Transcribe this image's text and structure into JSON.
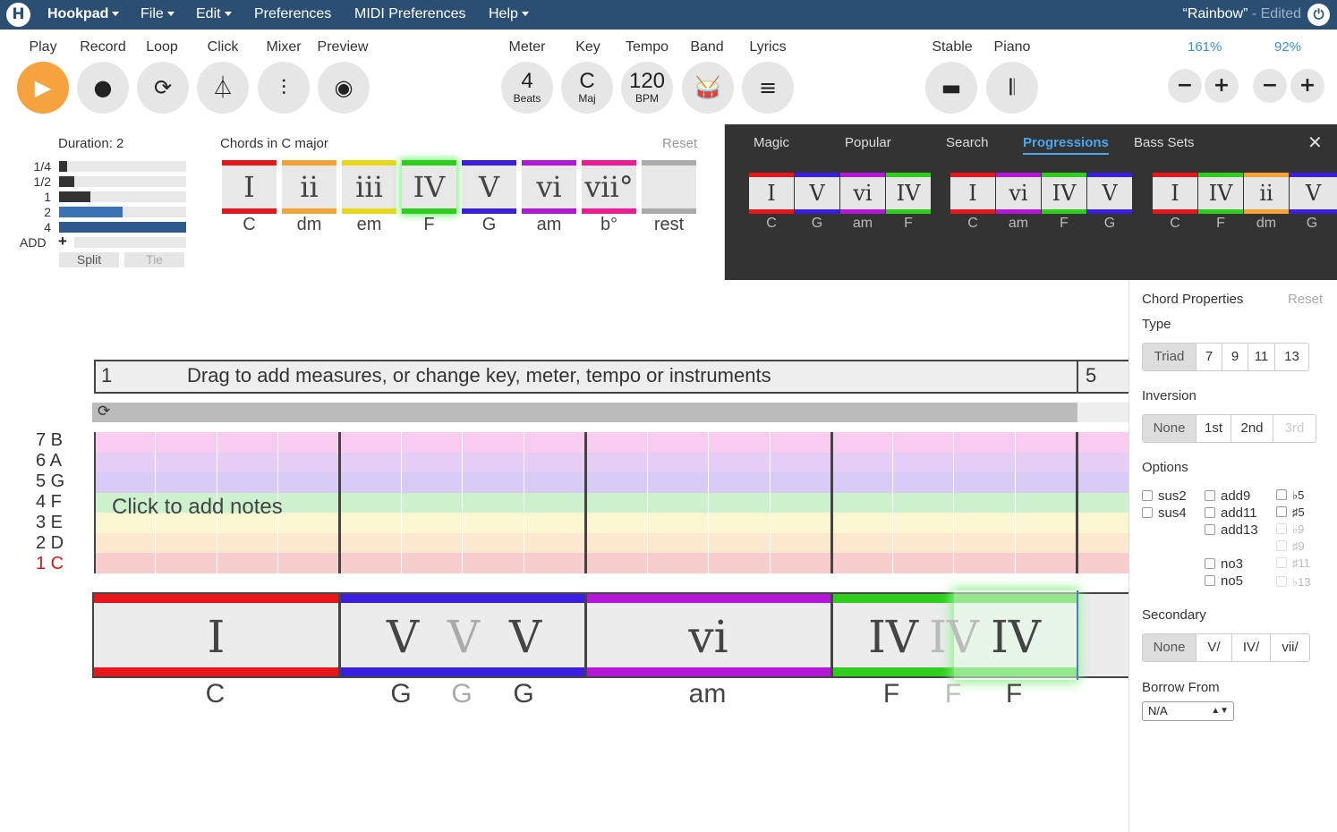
{
  "menubar": {
    "logo": "H",
    "app": "Hookpad",
    "items": [
      "File",
      "Edit",
      "Preferences",
      "MIDI Preferences",
      "Help"
    ],
    "doc_title": "“Rainbow”",
    "doc_status": "- Edited"
  },
  "toolbar": {
    "play": "Play",
    "record": "Record",
    "loop": "Loop",
    "click": "Click",
    "mixer": "Mixer",
    "preview": "Preview",
    "meter": "Meter",
    "meter_value": "4",
    "meter_unit": "Beats",
    "key": "Key",
    "key_value": "C",
    "key_unit": "Maj",
    "tempo": "Tempo",
    "tempo_value": "120",
    "tempo_unit": "BPM",
    "band": "Band",
    "lyrics": "Lyrics",
    "stable": "Stable",
    "piano": "Piano",
    "zoom1": "161%",
    "zoom2": "92%",
    "minus": "−",
    "plus": "+"
  },
  "duration": {
    "title": "Duration:",
    "value": "2",
    "rows": [
      {
        "label": "1/4",
        "level": 0.06
      },
      {
        "label": "1/2",
        "level": 0.12
      },
      {
        "label": "1",
        "level": 0.25
      },
      {
        "label": "2",
        "level": 0.5
      },
      {
        "label": "4",
        "level": 1.0
      }
    ],
    "add": "ADD",
    "add_icon": "+",
    "split": "Split",
    "tie": "Tie"
  },
  "palette": {
    "title": "Chords in C major",
    "reset": "Reset",
    "chords": [
      {
        "rn": "I",
        "name": "C",
        "color": "#e8151b"
      },
      {
        "rn": "ii",
        "name": "dm",
        "color": "#f5a331"
      },
      {
        "rn": "iii",
        "name": "em",
        "color": "#e8d816"
      },
      {
        "rn": "IV",
        "name": "F",
        "color": "#2fcd1e"
      },
      {
        "rn": "V",
        "name": "G",
        "color": "#3a1fe0"
      },
      {
        "rn": "vi",
        "name": "am",
        "color": "#b517d8"
      },
      {
        "rn": "vii°",
        "name": "b°",
        "color": "#f01b92"
      },
      {
        "rn": "",
        "name": "rest",
        "color": "#aaaaaa"
      }
    ]
  },
  "progressions": {
    "tabs": [
      "Magic",
      "Popular",
      "Search",
      "Progressions",
      "Bass Sets"
    ],
    "active_tab": "Progressions",
    "close": "✕",
    "groups": [
      [
        {
          "rn": "I",
          "name": "C",
          "color": "#e8151b"
        },
        {
          "rn": "V",
          "name": "G",
          "color": "#3a1fe0"
        },
        {
          "rn": "vi",
          "name": "am",
          "color": "#b517d8"
        },
        {
          "rn": "IV",
          "name": "F",
          "color": "#2fcd1e"
        }
      ],
      [
        {
          "rn": "I",
          "name": "C",
          "color": "#e8151b"
        },
        {
          "rn": "vi",
          "name": "am",
          "color": "#b517d8"
        },
        {
          "rn": "IV",
          "name": "F",
          "color": "#2fcd1e"
        },
        {
          "rn": "V",
          "name": "G",
          "color": "#3a1fe0"
        }
      ],
      [
        {
          "rn": "I",
          "name": "C",
          "color": "#e8151b"
        },
        {
          "rn": "IV",
          "name": "F",
          "color": "#2fcd1e"
        },
        {
          "rn": "ii",
          "name": "dm",
          "color": "#f5a331"
        },
        {
          "rn": "V",
          "name": "G",
          "color": "#3a1fe0"
        }
      ]
    ]
  },
  "sheet": {
    "measure_start": "1",
    "measure_hint": "Drag to add measures, or change key, meter, tempo or instruments",
    "measure_next": "5",
    "loop_icon": "⟳",
    "notes_hint": "Click to add notes",
    "note_rows": [
      {
        "label": "7 B",
        "color": "#f8ccf0"
      },
      {
        "label": "6 A",
        "color": "#e6cdf5"
      },
      {
        "label": "5 G",
        "color": "#d8ccf6"
      },
      {
        "label": "4 F",
        "color": "#cdf0cd"
      },
      {
        "label": "3 E",
        "color": "#fbf6d2"
      },
      {
        "label": "2 D",
        "color": "#fce8ce"
      },
      {
        "label": "1 C",
        "color": "#f8cdcd"
      }
    ],
    "chords": [
      {
        "rn": "I",
        "name": "C",
        "color": "#e8151b",
        "faded": false
      },
      {
        "rn": "V",
        "name": "G",
        "color": "#3a1fe0",
        "faded": false
      },
      {
        "rn": "V",
        "name": "G",
        "color": "#3a1fe0",
        "faded": true
      },
      {
        "rn": "V",
        "name": "G",
        "color": "#3a1fe0",
        "faded": false
      },
      {
        "rn": "vi",
        "name": "am",
        "color": "#b517d8",
        "faded": false
      },
      {
        "rn": "IV",
        "name": "F",
        "color": "#2fcd1e",
        "faded": false
      },
      {
        "rn": "IV",
        "name": "F",
        "color": "#2fcd1e",
        "faded": true
      },
      {
        "rn": "IV",
        "name": "F",
        "color": "#2fcd1e",
        "faded": false
      }
    ]
  },
  "properties": {
    "title": "Chord Properties",
    "reset": "Reset",
    "type_label": "Type",
    "types": [
      "Triad",
      "7",
      "9",
      "11",
      "13"
    ],
    "inversion_label": "Inversion",
    "inversions": [
      "None",
      "1st",
      "2nd",
      "3rd"
    ],
    "options_label": "Options",
    "opt_col1": [
      "sus2",
      "sus4"
    ],
    "opt_col2": [
      "add9",
      "add11",
      "add13",
      "no3",
      "no5"
    ],
    "opt_col3": [
      "♭5",
      "♯5",
      "♭9",
      "♯9",
      "♯11",
      "♭13"
    ],
    "secondary_label": "Secondary",
    "secondaries": [
      "None",
      "V/",
      "IV/",
      "vii/"
    ],
    "borrow_label": "Borrow From",
    "borrow_value": "N/A"
  }
}
